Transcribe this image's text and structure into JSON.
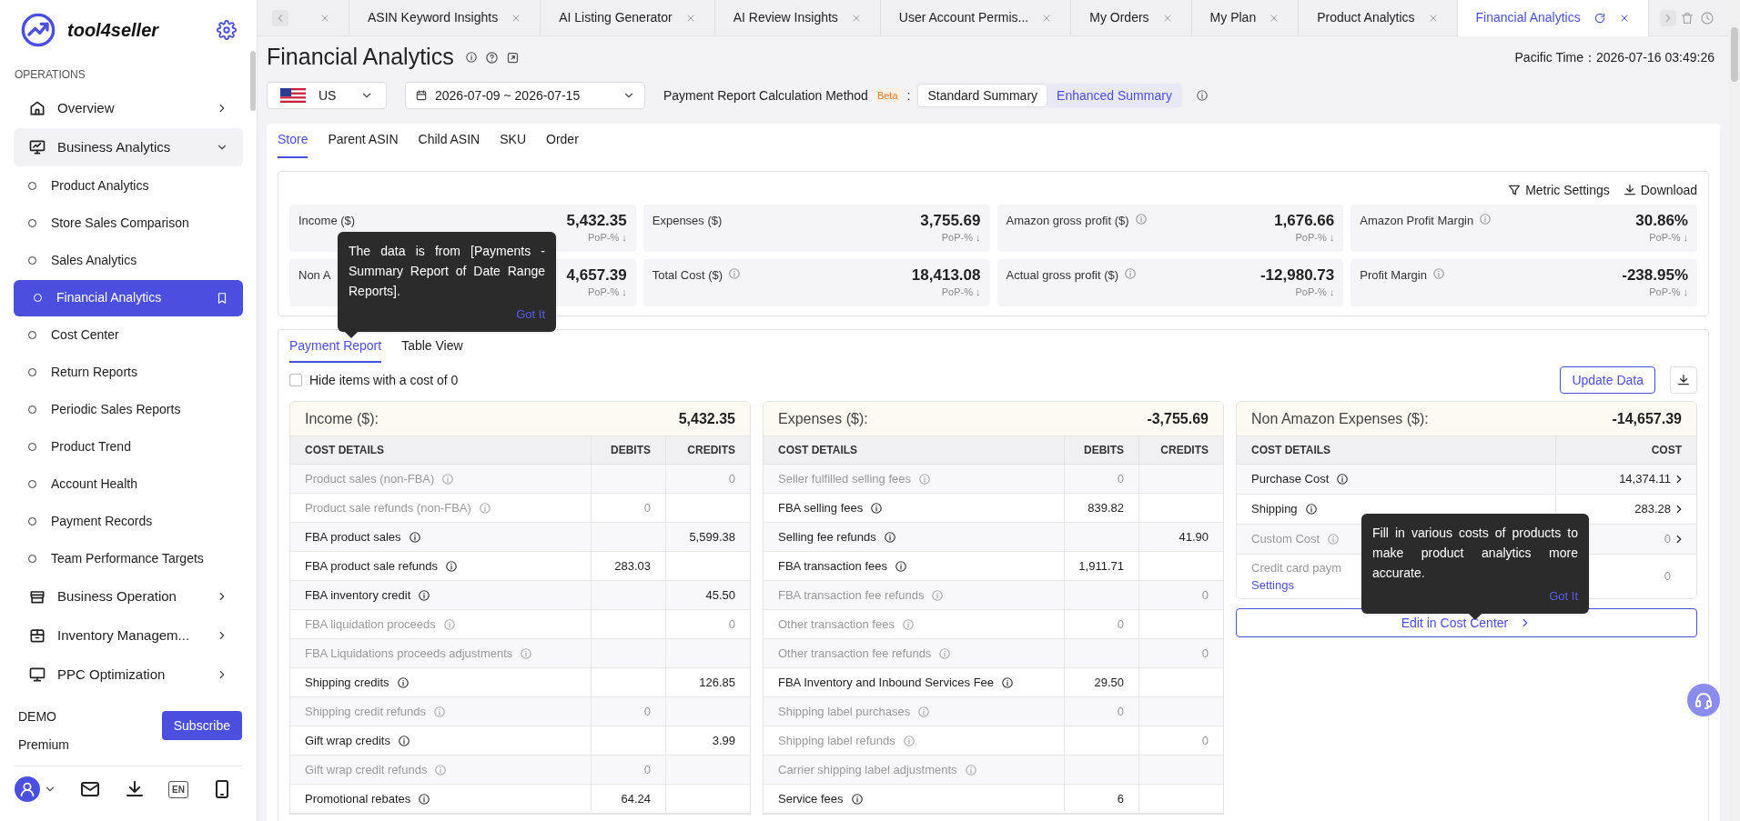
{
  "sidebar": {
    "brand": "tool4seller",
    "section": "OPERATIONS",
    "items": [
      {
        "label": "Overview",
        "expanded": false
      },
      {
        "label": "Business Analytics",
        "expanded": true,
        "children": [
          {
            "label": "Product Analytics",
            "selected": false
          },
          {
            "label": "Store Sales Comparison",
            "selected": false
          },
          {
            "label": "Sales Analytics",
            "selected": false
          },
          {
            "label": "Financial Analytics",
            "selected": true
          },
          {
            "label": "Cost Center",
            "selected": false
          },
          {
            "label": "Return Reports",
            "selected": false
          },
          {
            "label": "Periodic Sales Reports",
            "selected": false
          },
          {
            "label": "Product Trend",
            "selected": false
          },
          {
            "label": "Account Health",
            "selected": false
          },
          {
            "label": "Payment Records",
            "selected": false
          },
          {
            "label": "Team Performance Targets",
            "selected": false
          }
        ]
      },
      {
        "label": "Business Operation",
        "expanded": false
      },
      {
        "label": "Inventory Managem...",
        "expanded": false
      },
      {
        "label": "PPC Optimization",
        "expanded": false
      }
    ],
    "account": "DEMO",
    "plan": "Premium",
    "subscribe": "Subscribe",
    "language": "EN"
  },
  "tabs": [
    {
      "selected": false
    },
    {
      "label": "ASIN Keyword Insights",
      "selected": false
    },
    {
      "label": "AI Listing Generator",
      "selected": false
    },
    {
      "label": "AI Review Insights",
      "selected": false
    },
    {
      "label": "User Account Permis...",
      "selected": false
    },
    {
      "label": "My Orders",
      "selected": false
    },
    {
      "label": "My Plan",
      "selected": false
    },
    {
      "label": "Product Analytics",
      "selected": false
    },
    {
      "label": "Financial Analytics",
      "selected": true
    }
  ],
  "page": {
    "title": "Financial Analytics",
    "time": "Pacific Time：2026-07-16 03:49:26"
  },
  "filters": {
    "country": "US",
    "date_range": "2026-07-09 ~ 2026-07-15",
    "method_label": "Payment Report Calculation Method",
    "badge": "Beta",
    "colon": ":",
    "methods": [
      {
        "label": "Standard Summary",
        "selected": false
      },
      {
        "label": "Enhanced Summary",
        "selected": true
      }
    ]
  },
  "view_tabs": [
    {
      "label": "Store",
      "selected": true
    },
    {
      "label": "Parent ASIN",
      "selected": false
    },
    {
      "label": "Child ASIN",
      "selected": false
    },
    {
      "label": "SKU",
      "selected": false
    },
    {
      "label": "Order",
      "selected": false
    }
  ],
  "metric_actions": [
    "Metric Settings",
    "Download"
  ],
  "metrics": [
    {
      "label": "Income ($)",
      "value": "5,432.35",
      "pop": "PoP-% ↓",
      "info": false
    },
    {
      "label": "Expenses ($)",
      "value": "3,755.69",
      "pop": "PoP-% ↓",
      "info": false
    },
    {
      "label": "Amazon gross profit ($)",
      "value": "1,676.66",
      "pop": "PoP-% ↓",
      "info": true
    },
    {
      "label": "Amazon Profit Margin",
      "value": "30.86%",
      "pop": "PoP-% ↓",
      "info": true
    },
    {
      "label": "Non A",
      "value": "4,657.39",
      "pop": "PoP-% ↓",
      "info": false
    },
    {
      "label": "Total Cost ($)",
      "value": "18,413.08",
      "pop": "PoP-% ↓",
      "info": true
    },
    {
      "label": "Actual gross profit ($)",
      "value": "-12,980.73",
      "pop": "PoP-% ↓",
      "info": true
    },
    {
      "label": "Profit Margin",
      "value": "-238.95%",
      "pop": "PoP-% ↓",
      "info": true
    }
  ],
  "tooltip_data": {
    "text": "The data is from [Payments - Summary Report of Date Range Reports].",
    "action": "Got It"
  },
  "report_tabs": [
    {
      "label": "Payment Report",
      "selected": true
    },
    {
      "label": "Table View",
      "selected": false
    }
  ],
  "hide_zero": {
    "label": "Hide items with a cost of 0",
    "checked": false
  },
  "update_button": "Update Data",
  "tables": [
    {
      "title": "Income ($):",
      "total": "5,432.35",
      "columns": [
        "COST DETAILS",
        "DEBITS",
        "CREDITS"
      ],
      "rows": [
        {
          "label": "Product sales (non-FBA)",
          "debit": "",
          "credit": "0",
          "muted": true
        },
        {
          "label": "Product sale refunds (non-FBA)",
          "debit": "0",
          "credit": "",
          "muted": true
        },
        {
          "label": "FBA product sales",
          "debit": "",
          "credit": "5,599.38",
          "muted": false
        },
        {
          "label": "FBA product sale refunds",
          "debit": "283.03",
          "credit": "",
          "muted": false
        },
        {
          "label": "FBA inventory credit",
          "debit": "",
          "credit": "45.50",
          "muted": false
        },
        {
          "label": "FBA liquidation proceeds",
          "debit": "",
          "credit": "0",
          "muted": true
        },
        {
          "label": "FBA Liquidations proceeds adjustments",
          "debit": "",
          "credit": "",
          "muted": true
        },
        {
          "label": "Shipping credits",
          "debit": "",
          "credit": "126.85",
          "muted": false
        },
        {
          "label": "Shipping credit refunds",
          "debit": "0",
          "credit": "",
          "muted": true
        },
        {
          "label": "Gift wrap credits",
          "debit": "",
          "credit": "3.99",
          "muted": false
        },
        {
          "label": "Gift wrap credit refunds",
          "debit": "0",
          "credit": "",
          "muted": true
        },
        {
          "label": "Promotional rebates",
          "debit": "64.24",
          "credit": "",
          "muted": false
        }
      ]
    },
    {
      "title": "Expenses ($):",
      "total": "-3,755.69",
      "columns": [
        "COST DETAILS",
        "DEBITS",
        "CREDITS"
      ],
      "rows": [
        {
          "label": "Seller fulfilled selling fees",
          "debit": "0",
          "credit": "",
          "muted": true
        },
        {
          "label": "FBA selling fees",
          "debit": "839.82",
          "credit": "",
          "muted": false
        },
        {
          "label": "Selling fee refunds",
          "debit": "",
          "credit": "41.90",
          "muted": false
        },
        {
          "label": "FBA transaction fees",
          "debit": "1,911.71",
          "credit": "",
          "muted": false
        },
        {
          "label": "FBA transaction fee refunds",
          "debit": "",
          "credit": "0",
          "muted": true
        },
        {
          "label": "Other transaction fees",
          "debit": "0",
          "credit": "",
          "muted": true
        },
        {
          "label": "Other transaction fee refunds",
          "debit": "",
          "credit": "0",
          "muted": true
        },
        {
          "label": "FBA Inventory and Inbound Services Fee",
          "debit": "29.50",
          "credit": "",
          "muted": false
        },
        {
          "label": "Shipping label purchases",
          "debit": "0",
          "credit": "",
          "muted": true
        },
        {
          "label": "Shipping label refunds",
          "debit": "",
          "credit": "0",
          "muted": true
        },
        {
          "label": "Carrier shipping label adjustments",
          "debit": "",
          "credit": "",
          "muted": true
        },
        {
          "label": "Service fees",
          "debit": "6",
          "credit": "",
          "muted": false
        }
      ]
    }
  ],
  "non_amazon": {
    "title": "Non Amazon Expenses ($):",
    "total": "-14,657.39",
    "columns": [
      "COST DETAILS",
      "COST"
    ],
    "rows": [
      {
        "label": "Purchase Cost",
        "cost": "14,374.11",
        "muted": false,
        "arrow": true
      },
      {
        "label": "Shipping",
        "cost": "283.28",
        "muted": false,
        "arrow": true
      },
      {
        "label": "Custom Cost",
        "cost": "0",
        "muted": true,
        "arrow": true
      },
      {
        "label": "Credit card paym",
        "link": "Settings",
        "cost": "0",
        "muted": true,
        "arrow": false
      }
    ],
    "edit_button": "Edit in Cost Center",
    "tooltip": {
      "text": "Fill in various costs of products to make product analytics more accurate.",
      "action": "Got It"
    }
  }
}
